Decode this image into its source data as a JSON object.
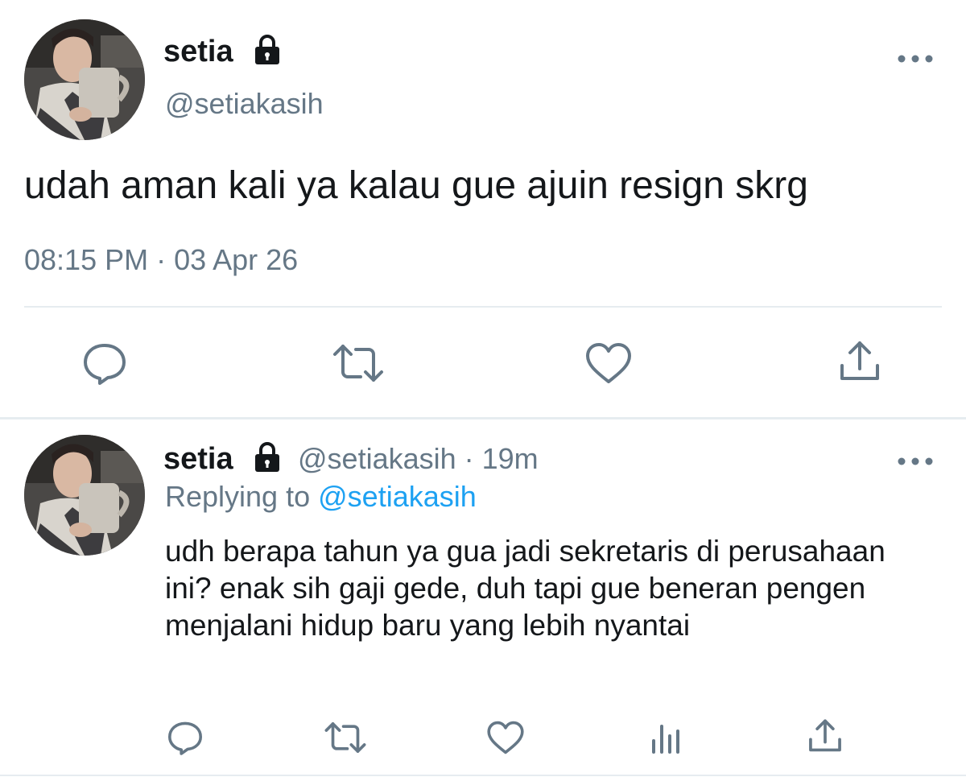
{
  "main_tweet": {
    "display_name": "setia",
    "handle": "@setiakasih",
    "text": "udah aman kali ya kalau gue ajuin resign skrg",
    "timestamp": "08:15 PM · 03 Apr 26",
    "icons": [
      "lock-icon",
      "more-icon",
      "reply-icon",
      "retweet-icon",
      "like-icon",
      "share-icon"
    ]
  },
  "reply_tweet": {
    "display_name": "setia",
    "handle_time": "@setiakasih · 19m",
    "replying_prefix": "Replying to",
    "replying_mention": "@setiakasih",
    "text": "udh berapa tahun ya gua jadi sekretaris di perusahaan ini? enak sih gaji gede, duh tapi gue beneran pengen menjalani hidup baru yang lebih nyantai",
    "icons": [
      "lock-icon",
      "more-icon",
      "reply-icon",
      "retweet-icon",
      "like-icon",
      "analytics-icon",
      "share-icon"
    ]
  },
  "colors": {
    "text": "#14171a",
    "secondary": "#657786",
    "link": "#1da1f2",
    "divider": "#e6ecf0"
  }
}
